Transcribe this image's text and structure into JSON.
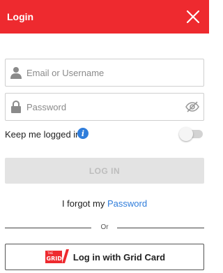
{
  "header": {
    "title": "Login",
    "close_icon": "close-icon",
    "background_color": "#ee2a2f"
  },
  "email_field": {
    "placeholder": "Email or Username",
    "value": "",
    "icon": "user-icon"
  },
  "password_field": {
    "placeholder": "Password",
    "value": "",
    "icon": "lock-icon",
    "visibility_icon": "eye-off-icon"
  },
  "keep_logged_in": {
    "label": "Keep me logged in",
    "info_icon": "info-icon",
    "info_glyph": "i",
    "enabled": false
  },
  "login_button": {
    "label": "LOG IN",
    "disabled": true
  },
  "forgot": {
    "prefix": "I forgot my ",
    "link": "Password",
    "link_color": "#2f7ddb"
  },
  "divider": {
    "text": "Or"
  },
  "grid_card_button": {
    "label": "Log in with Grid Card",
    "logo_text": "GRID",
    "logo_small_text": "THE",
    "logo_icon": "grid-card-logo"
  }
}
